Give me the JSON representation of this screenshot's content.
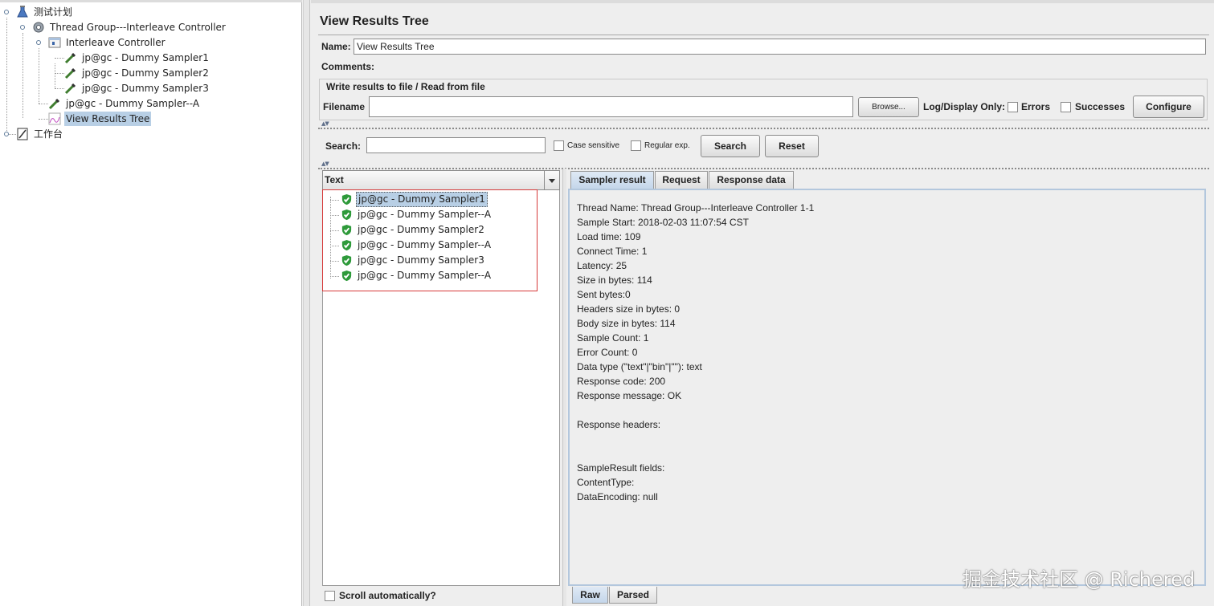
{
  "tree": {
    "test_plan": "测试计划",
    "thread_group": "Thread Group---Interleave Controller",
    "interleave_controller": "Interleave Controller",
    "sampler1": "jp@gc - Dummy Sampler1",
    "sampler2": "jp@gc - Dummy Sampler2",
    "sampler3": "jp@gc - Dummy Sampler3",
    "sampler_a": "jp@gc - Dummy Sampler--A",
    "view_results_tree": "View Results Tree",
    "workbench": "工作台"
  },
  "panel": {
    "title": "View Results Tree",
    "name_label": "Name:",
    "name_value": "View Results Tree",
    "comments_label": "Comments:",
    "file_group_title": "Write results to file / Read from file",
    "filename_label": "Filename",
    "filename_value": "",
    "browse_label": "Browse...",
    "log_display_label": "Log/Display Only:",
    "errors_label": "Errors",
    "successes_label": "Successes",
    "configure_label": "Configure"
  },
  "search": {
    "label": "Search:",
    "value": "",
    "case_sensitive_label": "Case sensitive",
    "regex_label": "Regular exp.",
    "search_button": "Search",
    "reset_button": "Reset"
  },
  "results": {
    "renderer_selected": "Text",
    "items": [
      "jp@gc - Dummy Sampler1",
      "jp@gc - Dummy Sampler--A",
      "jp@gc - Dummy Sampler2",
      "jp@gc - Dummy Sampler--A",
      "jp@gc - Dummy Sampler3",
      "jp@gc - Dummy Sampler--A"
    ],
    "scroll_auto_label": "Scroll automatically?"
  },
  "tabs": {
    "sampler_result": "Sampler result",
    "request": "Request",
    "response_data": "Response data"
  },
  "detail_lines": [
    "Thread Name: Thread Group---Interleave Controller 1-1",
    "Sample Start: 2018-02-03 11:07:54 CST",
    "Load time: 109",
    "Connect Time: 1",
    "Latency: 25",
    "Size in bytes: 114",
    "Sent bytes:0",
    "Headers size in bytes: 0",
    "Body size in bytes: 114",
    "Sample Count: 1",
    "Error Count: 0",
    "Data type (\"text\"|\"bin\"|\"\"): text",
    "Response code: 200",
    "Response message: OK",
    "",
    "Response headers:",
    "",
    "",
    "SampleResult fields:",
    "ContentType:",
    "DataEncoding: null"
  ],
  "bottom_tabs": {
    "raw": "Raw",
    "parsed": "Parsed"
  },
  "watermark": "掘金技术社区 @ Richered",
  "colors": {
    "selection": "#b8cfe5",
    "success_icon": "#2e9a3a",
    "highlight_box": "#d63a3a",
    "active_tab": "#c4d6ea"
  }
}
